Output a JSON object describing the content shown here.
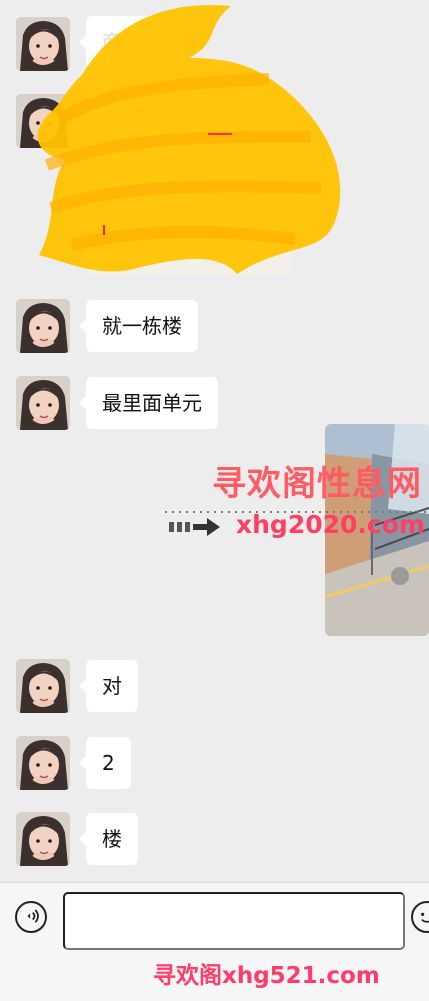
{
  "conversation": {
    "messages": [
      {
        "text": "商业局",
        "type": "text",
        "faded": true
      },
      {
        "text": "",
        "type": "image",
        "redacted": true
      },
      {
        "text": "就一栋楼",
        "type": "text"
      },
      {
        "text": "最里面单元",
        "type": "text"
      },
      {
        "text": "对",
        "type": "text"
      },
      {
        "text": "2",
        "type": "text"
      },
      {
        "text": "楼",
        "type": "text"
      }
    ]
  },
  "watermark": {
    "title": "寻欢阁性息网",
    "url": "xhg2020.com",
    "footer": "寻欢阁xhg521.com"
  },
  "input": {
    "placeholder": "",
    "value": ""
  },
  "icons": {
    "voice": "voice-icon",
    "emoji": "emoji-icon"
  },
  "colors": {
    "background": "#ededed",
    "bubble": "#ffffff",
    "scribble": "#ffc400",
    "watermark": "#ff5b63"
  }
}
